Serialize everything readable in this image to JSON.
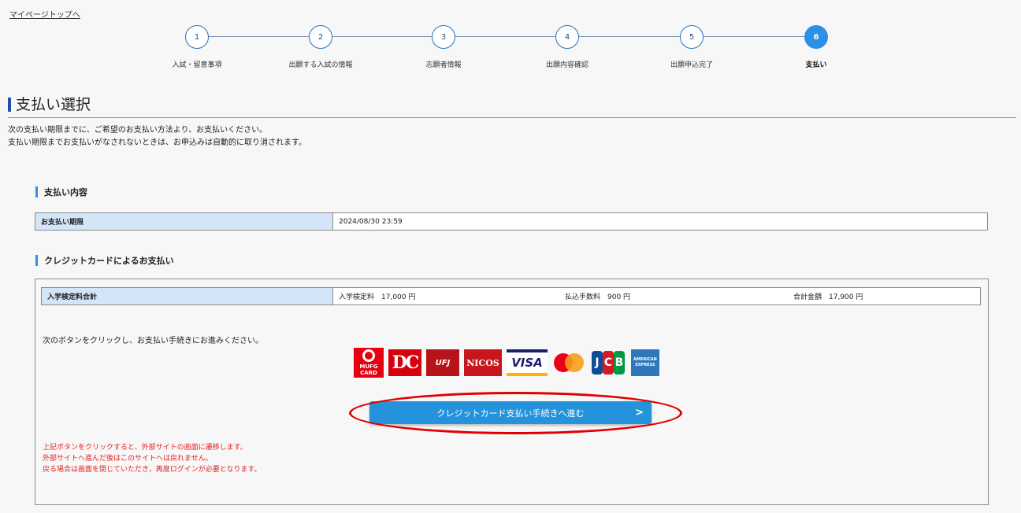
{
  "nav": {
    "top_link": "マイページトップへ"
  },
  "stepper": {
    "steps": [
      {
        "num": "1",
        "label": "入試・留意事項"
      },
      {
        "num": "2",
        "label": "出願する入試の情報"
      },
      {
        "num": "3",
        "label": "志願者情報"
      },
      {
        "num": "4",
        "label": "出願内容確認"
      },
      {
        "num": "5",
        "label": "出願申込完了"
      },
      {
        "num": "6",
        "label": "支払い"
      }
    ],
    "active_step": 6
  },
  "page": {
    "title": "支払い選択",
    "intro_line1": "次の支払い期限までに、ご希望のお支払い方法より、お支払いください。",
    "intro_line2": "支払い期限までお支払いがなされないときは、お申込みは自動的に取り消されます。"
  },
  "payment_details": {
    "heading": "支払い内容",
    "deadline_label": "お支払い期限",
    "deadline_value": "2024/08/30 23:59"
  },
  "credit_card": {
    "heading": "クレジットカードによるお支払い",
    "total_label": "入学検定料合計",
    "fee_text": "入学検定料　17,000 円",
    "handling_text": "払込手数料　900 円",
    "sum_text": "合計金額　17,900 円",
    "instruction": "次のボタンをクリックし、お支払い手続きにお進みください。",
    "button_label": "クレジットカード支払い手続きへ進む",
    "warning_line1": "上記ボタンをクリックすると、外部サイトの画面に遷移します。",
    "warning_line2": "外部サイトへ進んだ後はこのサイトへは戻れません。",
    "warning_line3": "戻る場合は画面を閉じていただき，再度ログインが必要となります。",
    "logos": {
      "mufg_line1": "MUFG",
      "mufg_line2": "CARD",
      "dc": "DC",
      "ufj": "UFJ",
      "nicos": "NICOS",
      "visa": "VISA",
      "jcb": [
        "J",
        "C",
        "B"
      ],
      "amex_line1": "AMERICAN",
      "amex_line2": "EXPRESS"
    }
  },
  "colors": {
    "accent": "#2e8fe6",
    "header_cell": "#d3e5f7",
    "warning": "#e52020",
    "highlight": "#e00000"
  }
}
